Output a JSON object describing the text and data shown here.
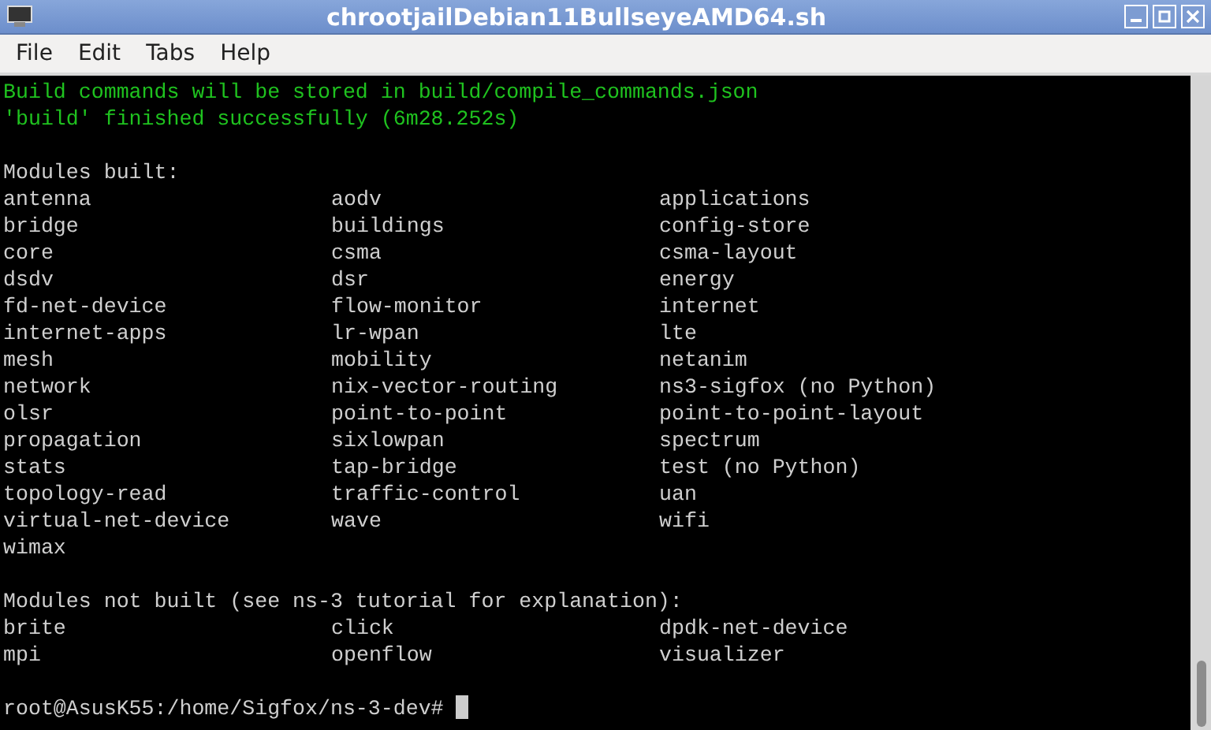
{
  "window": {
    "title": "chrootjailDebian11BullseyeAMD64.sh"
  },
  "menu": [
    "File",
    "Edit",
    "Tabs",
    "Help"
  ],
  "terminal": {
    "lines": [
      {
        "kind": "status",
        "text": "Build commands will be stored in build/compile_commands.json"
      },
      {
        "kind": "status",
        "text": "'build' finished successfully (6m28.252s)"
      },
      {
        "kind": "blank"
      },
      {
        "kind": "text",
        "text": "Modules built:"
      },
      {
        "kind": "columns",
        "cells": [
          "antenna",
          "aodv",
          "applications"
        ]
      },
      {
        "kind": "columns",
        "cells": [
          "bridge",
          "buildings",
          "config-store"
        ]
      },
      {
        "kind": "columns",
        "cells": [
          "core",
          "csma",
          "csma-layout"
        ]
      },
      {
        "kind": "columns",
        "cells": [
          "dsdv",
          "dsr",
          "energy"
        ]
      },
      {
        "kind": "columns",
        "cells": [
          "fd-net-device",
          "flow-monitor",
          "internet"
        ]
      },
      {
        "kind": "columns",
        "cells": [
          "internet-apps",
          "lr-wpan",
          "lte"
        ]
      },
      {
        "kind": "columns",
        "cells": [
          "mesh",
          "mobility",
          "netanim"
        ]
      },
      {
        "kind": "columns",
        "cells": [
          "network",
          "nix-vector-routing",
          "ns3-sigfox (no Python)"
        ]
      },
      {
        "kind": "columns",
        "cells": [
          "olsr",
          "point-to-point",
          "point-to-point-layout"
        ]
      },
      {
        "kind": "columns",
        "cells": [
          "propagation",
          "sixlowpan",
          "spectrum"
        ]
      },
      {
        "kind": "columns",
        "cells": [
          "stats",
          "tap-bridge",
          "test (no Python)"
        ]
      },
      {
        "kind": "columns",
        "cells": [
          "topology-read",
          "traffic-control",
          "uan"
        ]
      },
      {
        "kind": "columns",
        "cells": [
          "virtual-net-device",
          "wave",
          "wifi"
        ]
      },
      {
        "kind": "columns",
        "cells": [
          "wimax"
        ]
      },
      {
        "kind": "blank"
      },
      {
        "kind": "text",
        "text": "Modules not built (see ns-3 tutorial for explanation):"
      },
      {
        "kind": "columns",
        "cells": [
          "brite",
          "click",
          "dpdk-net-device"
        ]
      },
      {
        "kind": "columns",
        "cells": [
          "mpi",
          "openflow",
          "visualizer"
        ]
      },
      {
        "kind": "blank"
      },
      {
        "kind": "prompt",
        "text": "root@AsusK55:/home/Sigfox/ns-3-dev#"
      }
    ]
  }
}
